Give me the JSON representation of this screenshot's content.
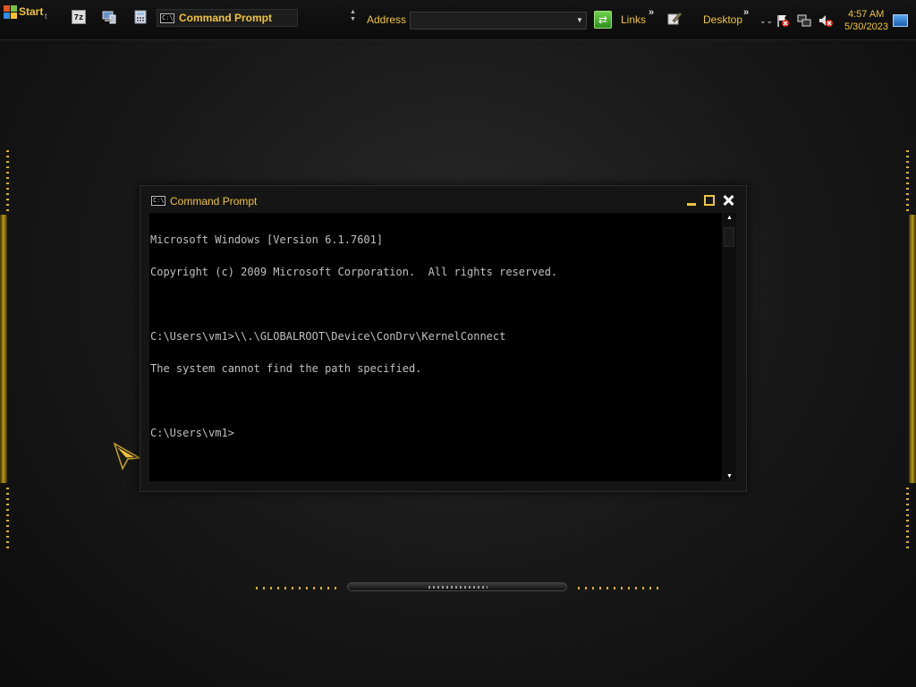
{
  "taskbar": {
    "start_label": "Start",
    "start_sub": "t",
    "quick_launch": [
      {
        "name": "7-zip-icon",
        "label": "7z"
      },
      {
        "name": "computer-icon"
      },
      {
        "name": "calculator-icon"
      }
    ],
    "task_button_label": "Command Prompt",
    "address_label": "Address",
    "address_value": "",
    "links_label": "Links",
    "desktop_label": "Desktop",
    "chevron": "»",
    "clock_time": "4:57 AM",
    "clock_date": "5/30/2023"
  },
  "window": {
    "title": "Command Prompt",
    "icon_text": "C:\\",
    "console_lines": [
      "Microsoft Windows [Version 6.1.7601]",
      "Copyright (c) 2009 Microsoft Corporation.  All rights reserved.",
      "",
      "C:\\Users\\vm1>\\\\.\\GLOBALROOT\\Device\\ConDrv\\KernelConnect",
      "The system cannot find the path specified.",
      "",
      "C:\\Users\\vm1>"
    ]
  },
  "colors": {
    "accent": "#f0c43a",
    "console_text": "#c0c0c0",
    "console_bg": "#000000"
  }
}
